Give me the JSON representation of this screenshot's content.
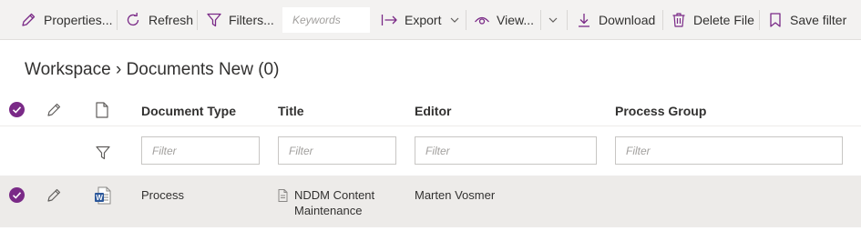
{
  "toolbar": {
    "properties_label": "Properties...",
    "refresh_label": "Refresh",
    "filters_label": "Filters...",
    "keywords_placeholder": "Keywords",
    "export_label": "Export",
    "view_label": "View...",
    "download_label": "Download",
    "delete_label": "Delete File",
    "save_filter_label": "Save filter"
  },
  "breadcrumb": "Workspace › Documents New (0)",
  "columns": {
    "document_type": "Document Type",
    "title": "Title",
    "editor": "Editor",
    "process_group": "Process Group"
  },
  "filters": {
    "placeholder": "Filter"
  },
  "rows": [
    {
      "document_type": "Process",
      "title_line1": "NDDM Content",
      "title_line2": "Maintenance",
      "editor": "Marten Vosmer",
      "process_group": "",
      "selected": true
    }
  ],
  "colors": {
    "accent": "#7a2a87",
    "toolbar_bg": "#f3f2f1",
    "row_selected_bg": "#edebe9",
    "word_blue": "#2b579a"
  }
}
